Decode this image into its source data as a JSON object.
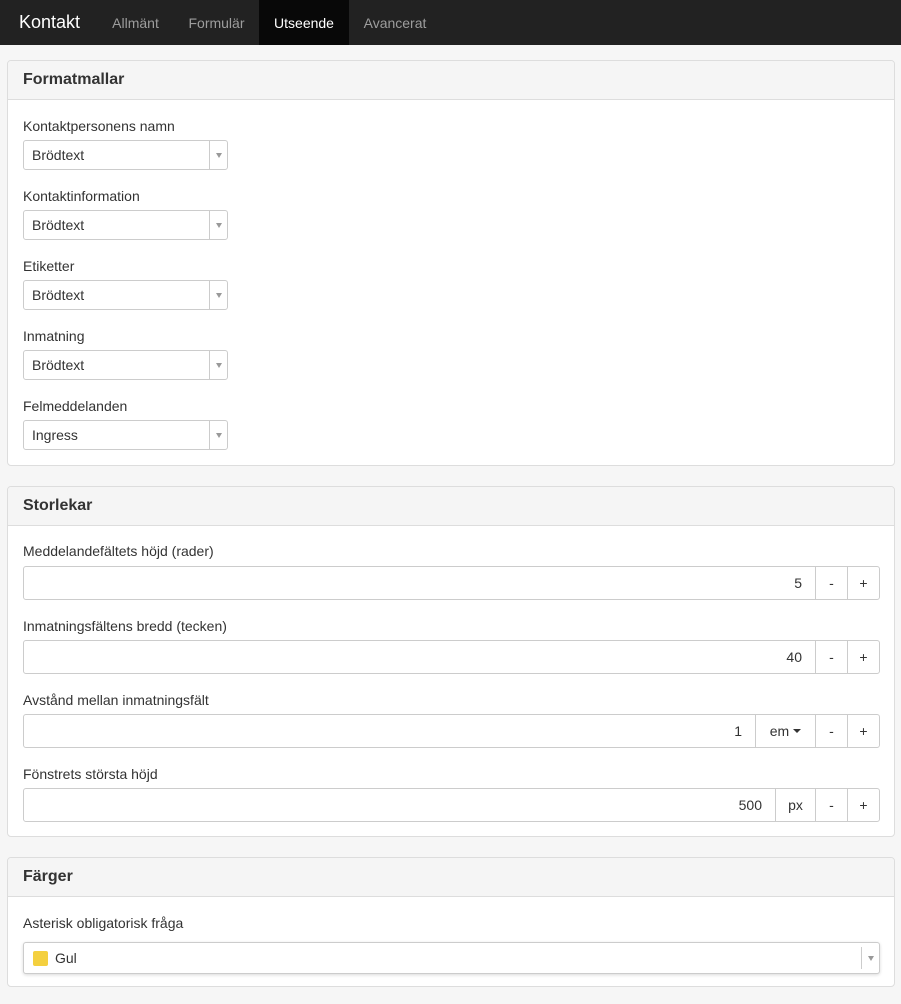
{
  "navbar": {
    "brand": "Kontakt",
    "tabs": [
      {
        "label": "Allmänt",
        "active": false
      },
      {
        "label": "Formulär",
        "active": false
      },
      {
        "label": "Utseende",
        "active": true
      },
      {
        "label": "Avancerat",
        "active": false
      }
    ]
  },
  "formatmallar": {
    "title": "Formatmallar",
    "fields": [
      {
        "label": "Kontaktpersonens namn",
        "value": "Brödtext"
      },
      {
        "label": "Kontaktinformation",
        "value": "Brödtext"
      },
      {
        "label": "Etiketter",
        "value": "Brödtext"
      },
      {
        "label": "Inmatning",
        "value": "Brödtext"
      },
      {
        "label": "Felmeddelanden",
        "value": "Ingress"
      }
    ]
  },
  "storlekar": {
    "title": "Storlekar",
    "fields": [
      {
        "label": "Meddelandefältets höjd (rader)",
        "value": "5",
        "unit": ""
      },
      {
        "label": "Inmatningsfältens bredd (tecken)",
        "value": "40",
        "unit": ""
      },
      {
        "label": "Avstånd mellan inmatningsfält",
        "value": "1",
        "unit": "em"
      },
      {
        "label": "Fönstrets största höjd",
        "value": "500",
        "unit": "px"
      }
    ],
    "minus": "-",
    "plus": "+"
  },
  "farger": {
    "title": "Färger",
    "field_label": "Asterisk obligatorisk fråga",
    "value": "Gul",
    "swatch_color": "#f4d03f"
  },
  "colors": {
    "navbar_bg": "#222222",
    "active_tab_bg": "#080808"
  }
}
